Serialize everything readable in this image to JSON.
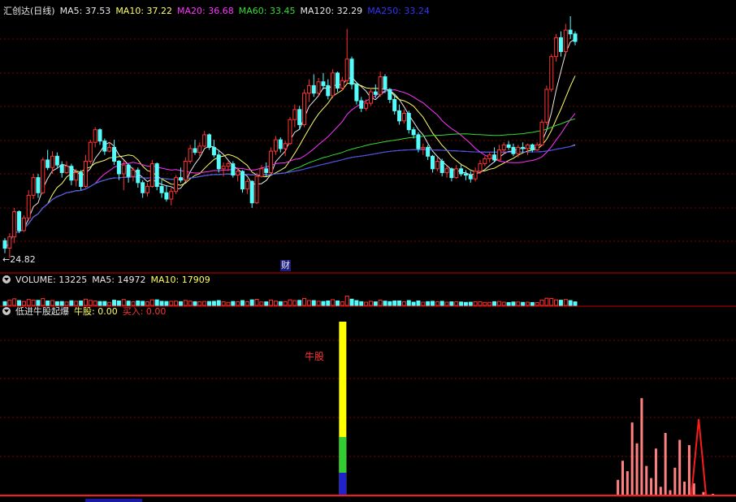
{
  "main_panel": {
    "stock_name": "汇创达(日线)",
    "indicators": [
      {
        "label": "MA5: 37.53",
        "color": "#e8e8e8"
      },
      {
        "label": "MA10: 37.22",
        "color": "#ffff66"
      },
      {
        "label": "MA20: 36.68",
        "color": "#ff33ff"
      },
      {
        "label": "MA60: 33.45",
        "color": "#33dd33"
      },
      {
        "label": "MA120: 32.29",
        "color": "#e8e8e8"
      },
      {
        "label": "MA250: 33.24",
        "color": "#3333ff"
      }
    ],
    "low_marker": "←24.82",
    "event_marker": "财"
  },
  "volume_panel": {
    "indicators": [
      {
        "label": "VOLUME: 13225",
        "color": "#e8e8e8"
      },
      {
        "label": "MA5: 14972",
        "color": "#e8e8e8"
      },
      {
        "label": "MA10: 17909",
        "color": "#ffff66"
      }
    ]
  },
  "signal_panel": {
    "title": "低进牛股起爆",
    "indicators": [
      {
        "label": "牛股: 0.00",
        "color": "#ffff66"
      },
      {
        "label": "买入: 0.00",
        "color": "#ff3333"
      }
    ],
    "signal_label": "牛股"
  },
  "colors": {
    "up": "#ff3333",
    "down": "#54fcfc",
    "grid": "#800000",
    "ma5": "#e8e8e8",
    "ma10": "#ffff66",
    "ma20": "#ff33ff",
    "ma60": "#33dd33",
    "ma120": "#e8e8e8",
    "ma250": "#3333ff"
  },
  "chart_data": {
    "type": "candlestick",
    "price_range": [
      24.8,
      44.0
    ],
    "candles": [
      [
        26.2,
        26.4,
        25.2,
        25.6
      ],
      [
        25.6,
        26.8,
        24.82,
        26.5
      ],
      [
        26.5,
        28.8,
        26.0,
        28.5
      ],
      [
        28.5,
        28.6,
        26.8,
        27.0
      ],
      [
        27.0,
        28.2,
        26.9,
        28.0
      ],
      [
        28.0,
        30.2,
        27.8,
        29.8
      ],
      [
        29.8,
        31.5,
        29.5,
        31.2
      ],
      [
        31.2,
        31.5,
        29.6,
        30.0
      ],
      [
        30.0,
        32.8,
        29.9,
        32.6
      ],
      [
        32.6,
        33.4,
        31.8,
        32.0
      ],
      [
        32.0,
        33.3,
        31.5,
        32.9
      ],
      [
        32.9,
        33.2,
        32.0,
        32.2
      ],
      [
        32.2,
        32.5,
        31.2,
        31.6
      ],
      [
        31.6,
        32.5,
        31.5,
        32.1
      ],
      [
        32.1,
        32.3,
        30.6,
        31.0
      ],
      [
        31.0,
        31.9,
        30.5,
        31.6
      ],
      [
        31.6,
        31.8,
        30.2,
        30.5
      ],
      [
        30.5,
        33.0,
        30.4,
        32.5
      ],
      [
        32.5,
        34.2,
        32.3,
        34.0
      ],
      [
        34.0,
        35.2,
        33.6,
        35.0
      ],
      [
        35.0,
        35.1,
        33.8,
        34.1
      ],
      [
        34.1,
        34.3,
        33.0,
        33.3
      ],
      [
        33.3,
        34.0,
        33.2,
        33.6
      ],
      [
        33.6,
        34.2,
        32.2,
        32.5
      ],
      [
        32.5,
        32.6,
        31.0,
        31.5
      ],
      [
        31.5,
        32.6,
        30.2,
        32.2
      ],
      [
        32.2,
        32.3,
        30.8,
        31.3
      ],
      [
        31.3,
        32.0,
        30.9,
        31.8
      ],
      [
        31.8,
        32.0,
        30.4,
        30.8
      ],
      [
        30.8,
        31.0,
        29.6,
        30.0
      ],
      [
        30.0,
        30.8,
        29.7,
        30.5
      ],
      [
        30.5,
        32.6,
        30.4,
        32.3
      ],
      [
        32.3,
        32.4,
        30.2,
        30.5
      ],
      [
        30.5,
        31.0,
        29.6,
        30.0
      ],
      [
        30.0,
        30.6,
        29.3,
        29.5
      ],
      [
        29.5,
        30.4,
        29.0,
        30.1
      ],
      [
        30.1,
        31.4,
        29.9,
        31.2
      ],
      [
        31.2,
        32.0,
        30.8,
        31.0
      ],
      [
        31.0,
        32.8,
        30.9,
        32.5
      ],
      [
        32.5,
        33.8,
        32.3,
        33.5
      ],
      [
        33.5,
        34.2,
        33.0,
        33.2
      ],
      [
        33.2,
        34.0,
        32.9,
        33.7
      ],
      [
        33.7,
        34.9,
        33.6,
        34.6
      ],
      [
        34.6,
        34.7,
        33.4,
        33.6
      ],
      [
        33.6,
        34.2,
        32.8,
        33.0
      ],
      [
        33.0,
        33.4,
        31.6,
        31.9
      ],
      [
        31.9,
        32.4,
        31.3,
        32.1
      ],
      [
        32.1,
        32.5,
        31.7,
        32.3
      ],
      [
        32.3,
        32.5,
        31.2,
        31.4
      ],
      [
        31.4,
        32.0,
        30.9,
        31.7
      ],
      [
        31.7,
        31.8,
        30.0,
        30.3
      ],
      [
        30.3,
        31.1,
        29.9,
        30.9
      ],
      [
        30.9,
        31.0,
        28.8,
        29.2
      ],
      [
        29.2,
        31.6,
        29.1,
        31.3
      ],
      [
        31.3,
        32.2,
        31.2,
        31.9
      ],
      [
        31.9,
        32.4,
        31.3,
        31.6
      ],
      [
        31.6,
        33.6,
        31.5,
        33.3
      ],
      [
        33.3,
        34.5,
        33.0,
        34.2
      ],
      [
        34.2,
        34.4,
        33.2,
        33.5
      ],
      [
        33.5,
        34.1,
        32.9,
        33.9
      ],
      [
        33.9,
        36.0,
        33.8,
        35.8
      ],
      [
        35.8,
        37.0,
        35.2,
        36.6
      ],
      [
        36.6,
        36.9,
        35.0,
        35.4
      ],
      [
        35.4,
        38.2,
        35.2,
        37.9
      ],
      [
        37.9,
        39.0,
        37.2,
        38.5
      ],
      [
        38.5,
        39.4,
        37.6,
        37.9
      ],
      [
        37.9,
        39.1,
        37.7,
        38.8
      ],
      [
        38.8,
        39.5,
        38.2,
        38.5
      ],
      [
        38.5,
        39.0,
        37.4,
        37.7
      ],
      [
        37.7,
        39.8,
        37.5,
        39.5
      ],
      [
        39.5,
        39.6,
        38.0,
        38.3
      ],
      [
        38.3,
        39.2,
        38.1,
        38.9
      ],
      [
        38.9,
        43.0,
        38.7,
        40.6
      ],
      [
        40.6,
        40.8,
        38.2,
        38.6
      ],
      [
        38.6,
        38.8,
        37.0,
        37.3
      ],
      [
        37.3,
        37.6,
        36.4,
        36.7
      ],
      [
        36.7,
        37.4,
        36.5,
        37.1
      ],
      [
        37.1,
        38.3,
        36.9,
        38.0
      ],
      [
        38.0,
        38.6,
        37.5,
        37.8
      ],
      [
        37.8,
        39.6,
        37.6,
        39.2
      ],
      [
        39.2,
        39.4,
        37.9,
        38.2
      ],
      [
        38.2,
        38.3,
        37.1,
        37.4
      ],
      [
        37.4,
        37.8,
        36.2,
        36.5
      ],
      [
        36.5,
        37.0,
        35.4,
        35.7
      ],
      [
        35.7,
        36.6,
        35.5,
        36.3
      ],
      [
        36.3,
        36.5,
        34.7,
        35.0
      ],
      [
        35.0,
        35.2,
        34.3,
        34.6
      ],
      [
        34.6,
        34.8,
        33.2,
        33.5
      ],
      [
        33.5,
        33.9,
        33.0,
        33.6
      ],
      [
        33.6,
        33.8,
        32.6,
        32.9
      ],
      [
        32.9,
        33.0,
        31.6,
        31.9
      ],
      [
        31.9,
        32.8,
        31.7,
        32.5
      ],
      [
        32.5,
        32.7,
        31.3,
        31.6
      ],
      [
        31.6,
        32.1,
        31.2,
        31.9
      ],
      [
        31.9,
        32.0,
        30.9,
        31.2
      ],
      [
        31.2,
        32.2,
        31.1,
        31.9
      ],
      [
        31.9,
        32.3,
        31.3,
        31.5
      ],
      [
        31.5,
        31.8,
        31.0,
        31.4
      ],
      [
        31.4,
        31.7,
        30.8,
        31.1
      ],
      [
        31.1,
        32.0,
        30.9,
        31.7
      ],
      [
        31.7,
        32.6,
        31.5,
        32.3
      ],
      [
        32.3,
        32.9,
        32.1,
        32.7
      ],
      [
        32.7,
        33.2,
        32.4,
        33.0
      ],
      [
        33.0,
        33.6,
        32.4,
        32.6
      ],
      [
        32.6,
        33.8,
        32.5,
        33.4
      ],
      [
        33.4,
        34.0,
        33.1,
        33.8
      ],
      [
        33.8,
        34.1,
        33.4,
        33.6
      ],
      [
        33.6,
        33.9,
        32.9,
        33.1
      ],
      [
        33.1,
        33.8,
        32.8,
        33.6
      ],
      [
        33.6,
        34.0,
        33.2,
        33.5
      ],
      [
        33.5,
        33.9,
        33.0,
        33.8
      ],
      [
        33.8,
        33.9,
        33.2,
        33.4
      ],
      [
        33.4,
        34.0,
        33.3,
        33.8
      ],
      [
        33.8,
        35.8,
        33.7,
        35.6
      ],
      [
        35.6,
        38.5,
        35.4,
        38.2
      ],
      [
        38.2,
        41.0,
        38.0,
        40.8
      ],
      [
        40.8,
        42.6,
        40.4,
        42.3
      ],
      [
        42.3,
        42.8,
        40.8,
        41.2
      ],
      [
        41.2,
        43.4,
        41.0,
        42.9
      ],
      [
        42.9,
        44.0,
        42.2,
        42.6
      ],
      [
        42.6,
        42.8,
        41.7,
        42.0
      ]
    ],
    "ma_values": {
      "MA5": 37.53,
      "MA10": 37.22,
      "MA20": 36.68,
      "MA60": 33.45,
      "MA120": 32.29,
      "MA250": 33.24
    },
    "volume": {
      "VOLUME": 13225,
      "MA5": 14972,
      "MA10": 17909
    },
    "signal": {
      "牛股": 0.0,
      "买入": 0.0,
      "signal_bar_index": 71,
      "buy_bars": [
        {
          "i": 129,
          "v": 0.09
        },
        {
          "i": 130,
          "v": 0.2
        },
        {
          "i": 131,
          "v": 0.14
        },
        {
          "i": 132,
          "v": 0.42
        },
        {
          "i": 133,
          "v": 0.3
        },
        {
          "i": 134,
          "v": 0.56
        },
        {
          "i": 135,
          "v": 0.17
        },
        {
          "i": 136,
          "v": 0.1
        },
        {
          "i": 137,
          "v": 0.27
        },
        {
          "i": 138,
          "v": 0.05
        },
        {
          "i": 139,
          "v": 0.36
        },
        {
          "i": 140,
          "v": 0.03
        },
        {
          "i": 141,
          "v": 0.16
        },
        {
          "i": 142,
          "v": 0.32
        },
        {
          "i": 143,
          "v": 0.08
        },
        {
          "i": 144,
          "v": 0.29
        },
        {
          "i": 145,
          "v": 0.07
        },
        {
          "i": 147,
          "v": 0.02
        },
        {
          "i": 149,
          "v": 0.01
        }
      ],
      "peak_index": 146,
      "peak_value": 0.44
    }
  }
}
